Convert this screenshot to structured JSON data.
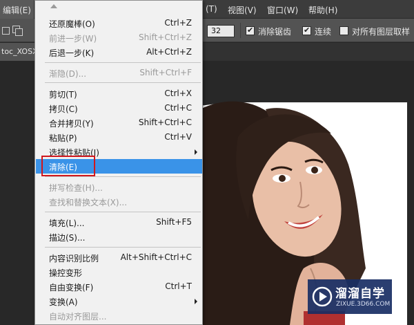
{
  "menubar": {
    "items": [
      "编辑(E)",
      "(T)",
      "视图(V)",
      "窗口(W)",
      "帮助(H)"
    ]
  },
  "options": {
    "size_value": "32",
    "antialias_label": "消除锯齿",
    "antialias_checked": true,
    "contiguous_label": "连续",
    "contiguous_checked": true,
    "sample_all_label": "对所有图层取样",
    "sample_all_checked": false
  },
  "tab": {
    "title": "toc_XOSX"
  },
  "menu": {
    "items": [
      {
        "label": "还原魔棒(O)",
        "shortcut": "Ctrl+Z",
        "disabled": false
      },
      {
        "label": "前进一步(W)",
        "shortcut": "Shift+Ctrl+Z",
        "disabled": true
      },
      {
        "label": "后退一步(K)",
        "shortcut": "Alt+Ctrl+Z",
        "disabled": false
      },
      {
        "label": "渐隐(D)...",
        "shortcut": "Shift+Ctrl+F",
        "disabled": true
      },
      {
        "label": "剪切(T)",
        "shortcut": "Ctrl+X",
        "disabled": false
      },
      {
        "label": "拷贝(C)",
        "shortcut": "Ctrl+C",
        "disabled": false
      },
      {
        "label": "合并拷贝(Y)",
        "shortcut": "Shift+Ctrl+C",
        "disabled": false
      },
      {
        "label": "粘贴(P)",
        "shortcut": "Ctrl+V",
        "disabled": false
      },
      {
        "label": "选择性粘贴(I)",
        "shortcut": "",
        "disabled": false,
        "submenu": true
      },
      {
        "label": "清除(E)",
        "shortcut": "",
        "disabled": false,
        "selected": true
      },
      {
        "label": "拼写检查(H)...",
        "shortcut": "",
        "disabled": true
      },
      {
        "label": "查找和替换文本(X)...",
        "shortcut": "",
        "disabled": true
      },
      {
        "label": "填充(L)...",
        "shortcut": "Shift+F5",
        "disabled": false
      },
      {
        "label": "描边(S)...",
        "shortcut": "",
        "disabled": false
      },
      {
        "label": "内容识别比例",
        "shortcut": "Alt+Shift+Ctrl+C",
        "disabled": false
      },
      {
        "label": "操控变形",
        "shortcut": "",
        "disabled": false
      },
      {
        "label": "自由变换(F)",
        "shortcut": "Ctrl+T",
        "disabled": false
      },
      {
        "label": "变换(A)",
        "shortcut": "",
        "disabled": false,
        "submenu": true
      },
      {
        "label": "自动对齐图层...",
        "shortcut": "",
        "disabled": true
      }
    ]
  },
  "watermark": {
    "title": "溜溜自学",
    "subtitle": "ZIXUE.3D66.COM"
  },
  "colors": {
    "selection": "#3a93e8",
    "highlight_box": "#d0161c",
    "watermark_bg": "#182e64"
  }
}
